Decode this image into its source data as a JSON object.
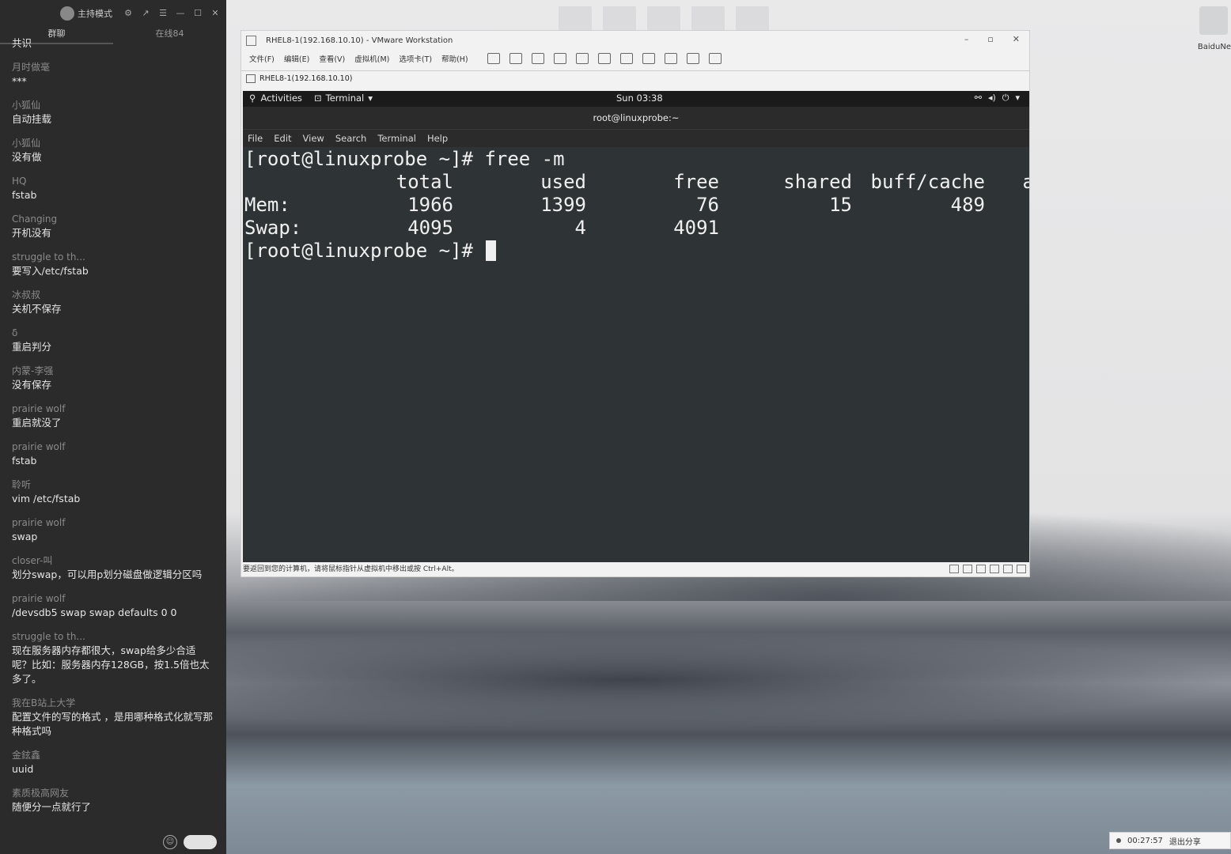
{
  "chat": {
    "mode_label": "主持模式",
    "tabs": [
      "群聊",
      "在线84"
    ],
    "messages": [
      {
        "nick": "",
        "text": "共识"
      },
      {
        "nick": "月时做毫",
        "text": "***"
      },
      {
        "nick": "小狐仙",
        "text": "自动挂载"
      },
      {
        "nick": "小狐仙",
        "text": "没有做"
      },
      {
        "nick": "HQ",
        "text": "fstab"
      },
      {
        "nick": "Changing",
        "text": "开机没有"
      },
      {
        "nick": "struggle to th...",
        "text": "要写入/etc/fstab"
      },
      {
        "nick": "冰叔叔",
        "text": "关机不保存"
      },
      {
        "nick": "δ",
        "text": "重启判分"
      },
      {
        "nick": "内蒙-李强",
        "text": "没有保存"
      },
      {
        "nick": "prairie wolf",
        "text": "重启就没了"
      },
      {
        "nick": "prairie wolf",
        "text": "fstab"
      },
      {
        "nick": "聆听",
        "text": "vim /etc/fstab"
      },
      {
        "nick": "prairie wolf",
        "text": "swap"
      },
      {
        "nick": "closer-叫",
        "text": "划分swap，可以用p划分磁盘做逻辑分区吗"
      },
      {
        "nick": "prairie wolf",
        "text": "/devsdb5 swap swap defaults 0 0"
      },
      {
        "nick": "struggle to th...",
        "text": "现在服务器内存都很大，swap给多少合适呢？比如：服务器内存128GB，按1.5倍也太多了。"
      },
      {
        "nick": "我在B站上大学",
        "text": "配置文件的写的格式 ，是用哪种格式化就写那种格式吗"
      },
      {
        "nick": "金鉉鑫",
        "text": "uuid"
      },
      {
        "nick": "素质极高网友",
        "text": "随便分一点就行了"
      }
    ]
  },
  "desktop": {
    "right_icon_label": "BaiduNe"
  },
  "vmware": {
    "title": "RHEL8-1(192.168.10.10) - VMware Workstation",
    "menu": [
      "文件(F)",
      "编辑(E)",
      "查看(V)",
      "虚拟机(M)",
      "选项卡(T)",
      "帮助(H)"
    ],
    "tab_label": "RHEL8-1(192.168.10.10)",
    "status_text": "要返回到您的计算机，请将鼠标指针从虚拟机中移出或按 Ctrl+Alt。"
  },
  "gnome": {
    "activities": "Activities",
    "app_menu": "Terminal",
    "clock": "Sun 03:38"
  },
  "terminal": {
    "title": "root@linuxprobe:~",
    "menu": [
      "File",
      "Edit",
      "View",
      "Search",
      "Terminal",
      "Help"
    ],
    "prompt": "[root@linuxprobe ~]#",
    "command": "free -m",
    "headers": [
      "total",
      "used",
      "free",
      "shared",
      "buff/cache",
      "a"
    ],
    "rows": [
      {
        "label": "Mem:",
        "values": [
          "1966",
          "1399",
          "76",
          "15",
          "489"
        ]
      },
      {
        "label": "Swap:",
        "values": [
          "4095",
          "4",
          "4091",
          "",
          ""
        ]
      }
    ]
  },
  "share_bar": {
    "timer": "00:27:57",
    "stop_label": "退出分享"
  }
}
